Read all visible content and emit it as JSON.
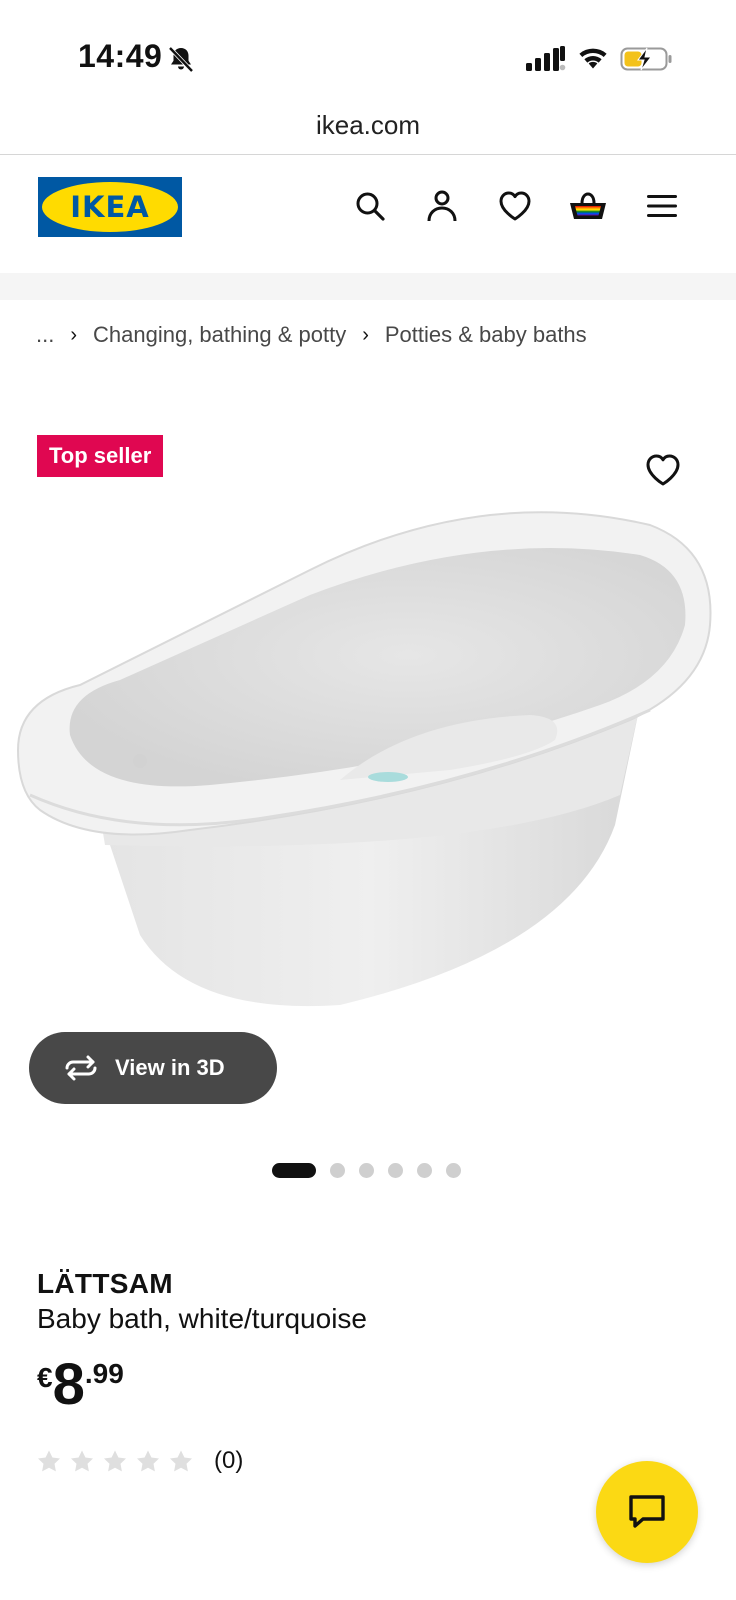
{
  "status_bar": {
    "time": "14:49",
    "icons": [
      "bell-muted-icon",
      "cellular-signal-icon",
      "wifi-icon",
      "battery-charging-icon"
    ]
  },
  "browser": {
    "url": "ikea.com"
  },
  "header": {
    "logo": "IKEA",
    "icons": [
      "search-icon",
      "account-icon",
      "heart-icon",
      "cart-icon",
      "menu-icon"
    ]
  },
  "breadcrumb": {
    "ellipsis": "...",
    "items": [
      "Changing, bathing & potty",
      "Potties & baby baths"
    ]
  },
  "product": {
    "badge": "Top seller",
    "view_3d_label": "View in 3D",
    "carousel": {
      "total": 6,
      "active_index": 0
    },
    "name": "LÄTTSAM",
    "description": "Baby bath, white/turquoise",
    "price": {
      "currency": "€",
      "integer": "8",
      "decimal": ".99"
    },
    "rating": {
      "stars": 0,
      "max_stars": 5,
      "count_text": "(0)"
    }
  },
  "colors": {
    "brand_blue": "#0058a3",
    "brand_yellow": "#ffdb00",
    "badge_red": "#e00751",
    "chat_yellow": "#fbd914"
  }
}
